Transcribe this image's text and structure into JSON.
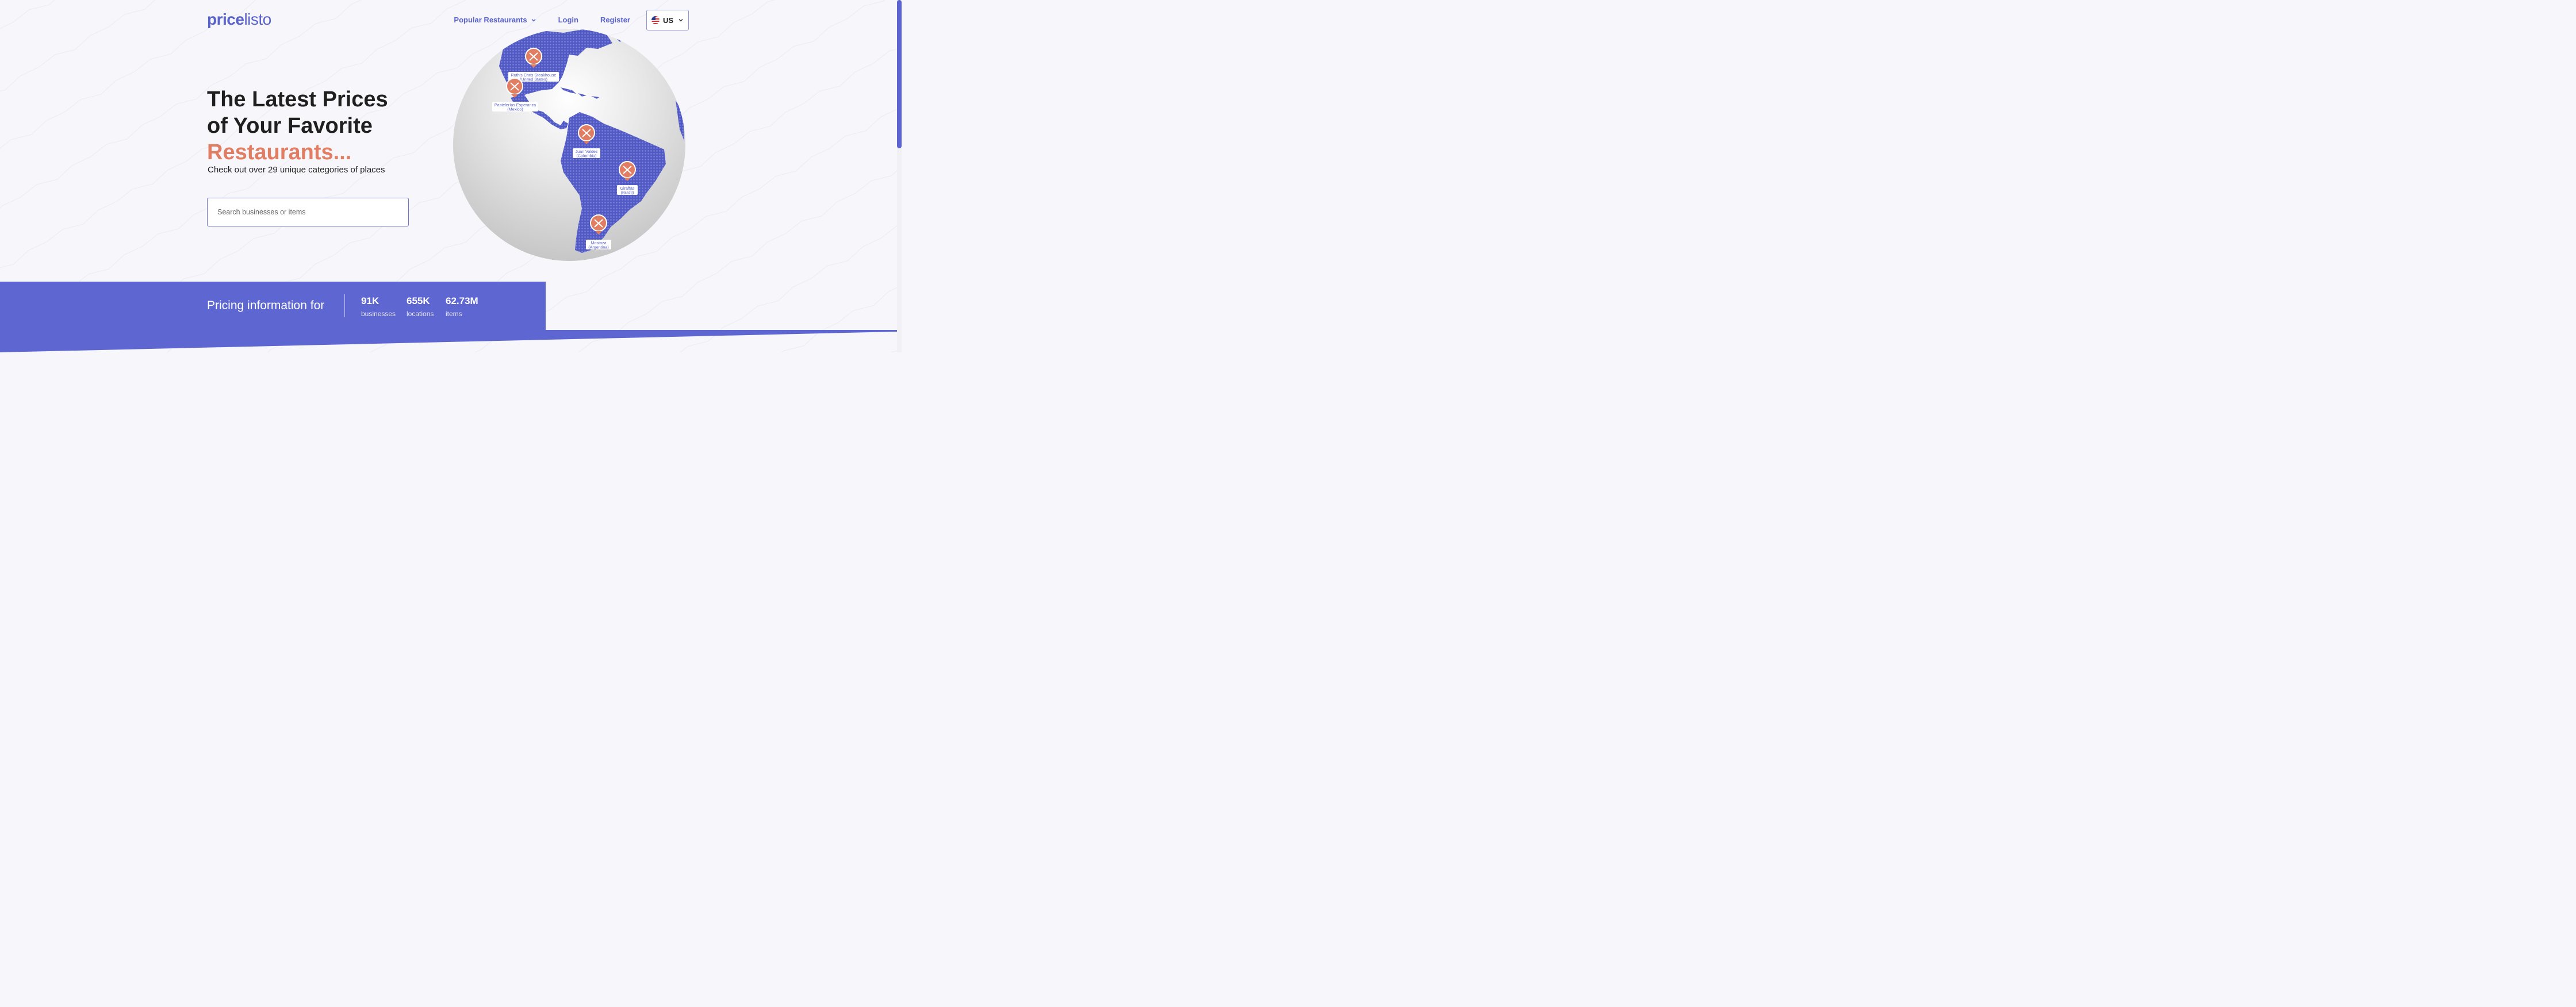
{
  "header": {
    "logo_bold": "price",
    "logo_light": "listo",
    "nav": {
      "popular": "Popular Restaurants",
      "login": "Login",
      "register": "Register"
    },
    "country": "US"
  },
  "hero": {
    "title_line1": "The Latest Prices",
    "title_line2": "of Your Favorite",
    "title_highlight": "Restaurants...",
    "subtitle": "Check out over 29 unique categories of places",
    "search_placeholder": "Search businesses or items"
  },
  "map_pins": [
    {
      "name": "Ruth's Chris Steakhouse",
      "country": "(United States)"
    },
    {
      "name": "Pastelerías Esperanza",
      "country": "(Mexico)"
    },
    {
      "name": "Juan Valdez",
      "country": "(Colombia)"
    },
    {
      "name": "Giraffas",
      "country": "(Brazil)"
    },
    {
      "name": "Mostaza",
      "country": "(Argentina)"
    }
  ],
  "stats": {
    "title": "Pricing information for",
    "items": [
      {
        "value": "91K",
        "label": "businesses"
      },
      {
        "value": "655K",
        "label": "locations"
      },
      {
        "value": "62.73M",
        "label": "items"
      }
    ]
  },
  "colors": {
    "brand": "#5a63cc",
    "accent": "#e07d62",
    "band": "#5d66d1"
  }
}
